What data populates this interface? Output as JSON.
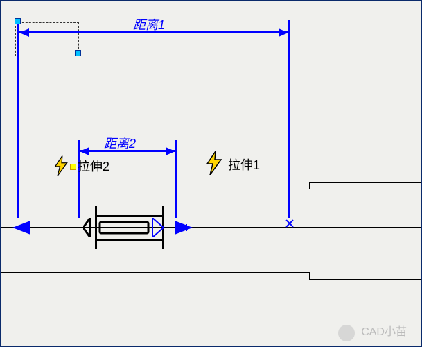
{
  "dimensions": {
    "top": {
      "label": "距离1"
    },
    "mid": {
      "label": "距离2"
    }
  },
  "annotations": {
    "stretch1": {
      "label": "拉伸1"
    },
    "stretch2": {
      "label": "拉伸2"
    }
  },
  "colors": {
    "blue": "#0000ff",
    "yellow": "#ffd400",
    "grip": "#00c0ff"
  },
  "watermark": {
    "text": "CAD小苗"
  }
}
